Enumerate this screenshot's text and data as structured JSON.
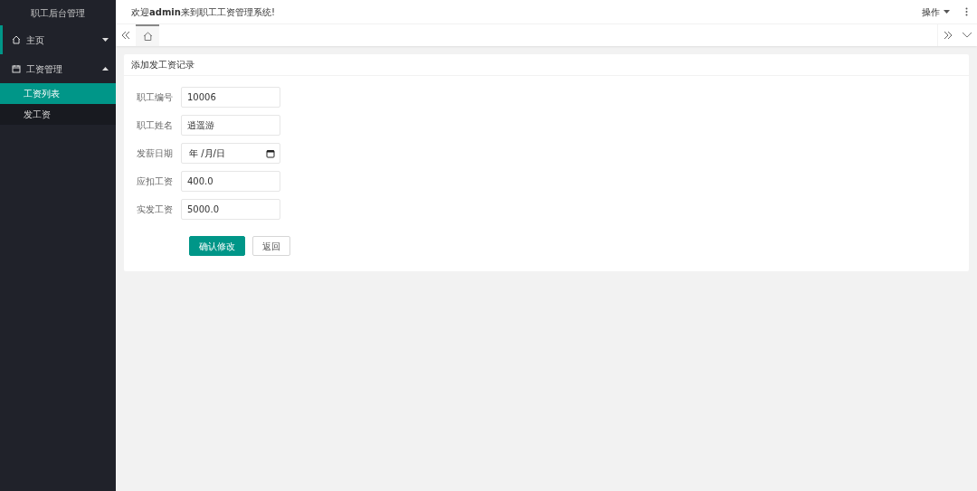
{
  "sidebar": {
    "title": "职工后台管理",
    "items": [
      {
        "label": "主页",
        "kind": "home",
        "selected": true,
        "expanded": false
      },
      {
        "label": "工资管理",
        "kind": "calendar",
        "selected": false,
        "expanded": true,
        "children": [
          {
            "label": "工资列表",
            "selected": true
          },
          {
            "label": "发工资",
            "selected": false
          }
        ]
      }
    ]
  },
  "header": {
    "welcome": "欢迎**admin**来到职工工资管理系统!",
    "menu": "操作"
  },
  "tabs": [
    {
      "kind": "home",
      "selected": true
    }
  ],
  "form": {
    "title": "添加发工资记录",
    "fields": [
      {
        "label": "职工编号",
        "kind": "text",
        "value": "10006"
      },
      {
        "label": "职工姓名",
        "kind": "text",
        "value": "逍遥游"
      },
      {
        "label": "发薪日期",
        "kind": "date",
        "placeholder": "年 /月/日"
      },
      {
        "label": "应扣工资",
        "kind": "text",
        "value": "400.0"
      },
      {
        "label": "实发工资",
        "kind": "text",
        "value": "5000.0"
      }
    ],
    "buttons": [
      {
        "label": "确认修改",
        "kind": "primary"
      },
      {
        "label": "返回",
        "kind": "secondary"
      }
    ]
  }
}
